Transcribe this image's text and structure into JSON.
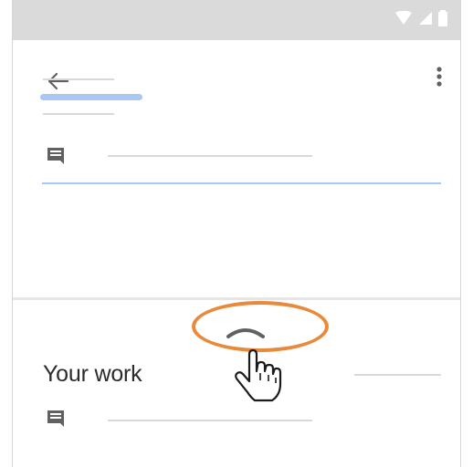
{
  "status_bar": {
    "icons": [
      "wifi-icon",
      "cell-signal-icon",
      "battery-icon"
    ]
  },
  "toolbar": {
    "back_icon": "arrow-left-icon",
    "menu_icon": "more-vert-icon"
  },
  "assignment": {
    "comment_icon": "comment-icon"
  },
  "bottom_sheet": {
    "handle_icon": "chevron-up-icon",
    "title": "Your work",
    "comment_icon": "comment-icon"
  },
  "colors": {
    "accent_blue": "#a9c7f5",
    "highlight_orange": "#e98a3a",
    "status_bar_bg": "#dadada",
    "icon_gray": "#616161"
  }
}
